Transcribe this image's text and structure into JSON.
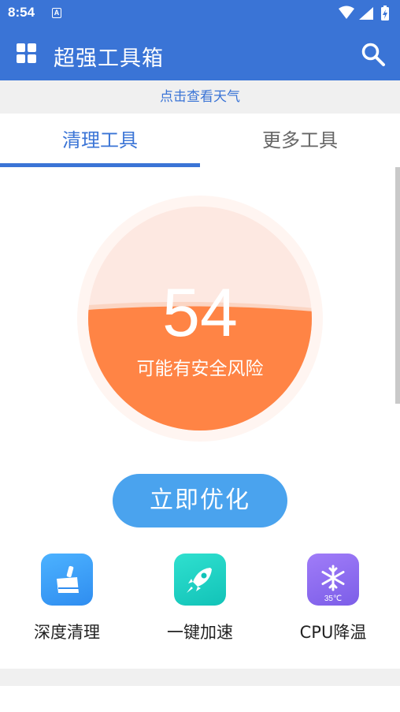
{
  "status_bar": {
    "time": "8:54",
    "notification": "A"
  },
  "app_bar": {
    "title": "超强工具箱"
  },
  "weather_link": "点击查看天气",
  "tabs": [
    {
      "label": "清理工具",
      "active": true
    },
    {
      "label": "更多工具",
      "active": false
    }
  ],
  "gauge": {
    "score": "54",
    "status": "可能有安全风险",
    "fill_fraction": 0.54
  },
  "optimize_button": "立即优化",
  "tools": [
    {
      "label": "深度清理",
      "icon": "broom-icon",
      "color": "#3b9ef5"
    },
    {
      "label": "一键加速",
      "icon": "rocket-icon",
      "color": "#1fd4c4"
    },
    {
      "label": "CPU降温",
      "icon": "snowflake-icon",
      "color": "#8f6ef0",
      "badge": "35℃"
    }
  ],
  "colors": {
    "primary": "#3a74d6",
    "gauge_fill": "#ff8445",
    "gauge_bg": "#fde8e1",
    "button": "#4aa3ee"
  }
}
